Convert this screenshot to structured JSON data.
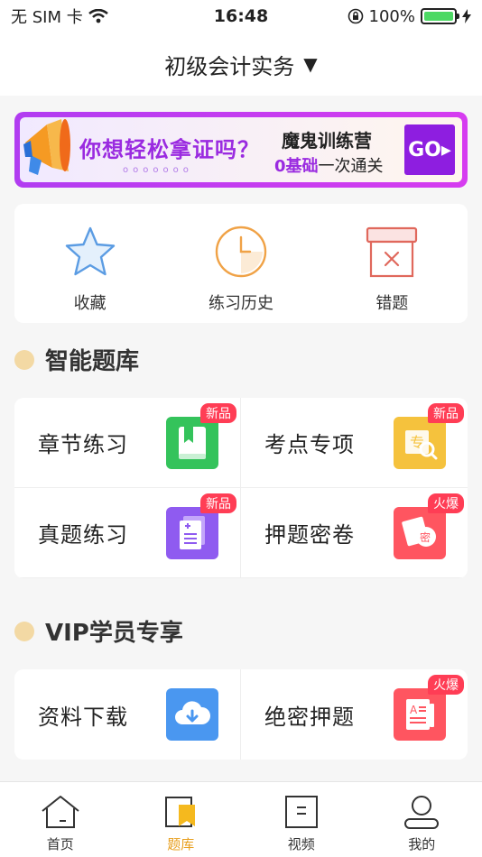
{
  "status_bar": {
    "carrier": "无 SIM 卡",
    "time": "16:48",
    "battery": "100%"
  },
  "header": {
    "title": "初级会计实务",
    "arrow": "▼"
  },
  "banner": {
    "headline": "你想轻松拿证吗？",
    "dots": "ooooooo",
    "right_title": "魔鬼训练营",
    "sub_highlight": "0基础",
    "sub_rest": "一次通关",
    "go": "GO▸"
  },
  "quick_actions": [
    {
      "label": "收藏",
      "icon": "star-icon"
    },
    {
      "label": "练习历史",
      "icon": "clock-icon"
    },
    {
      "label": "错题",
      "icon": "wrong-box-icon"
    }
  ],
  "smart_bank": {
    "title": "智能题库",
    "items": [
      {
        "label": "章节练习",
        "badge": "新品",
        "icon": "book-icon",
        "color": "#34c35b"
      },
      {
        "label": "考点专项",
        "badge": "新品",
        "icon": "topic-search-icon",
        "color": "#f5c23d"
      },
      {
        "label": "真题练习",
        "badge": "新品",
        "icon": "exam-doc-icon",
        "color": "#8f5bf0"
      },
      {
        "label": "押题密卷",
        "badge": "火爆",
        "icon": "secret-paper-icon",
        "color": "#ff5560"
      }
    ]
  },
  "vip": {
    "title": "VIP学员专享",
    "items": [
      {
        "label": "资料下载",
        "badge": "",
        "icon": "cloud-download-icon",
        "color": "#4a97f0"
      },
      {
        "label": "绝密押题",
        "badge": "火爆",
        "icon": "secret-file-icon",
        "color": "#ff5560"
      }
    ]
  },
  "tabbar": [
    {
      "label": "首页",
      "icon": "home-icon",
      "active": false
    },
    {
      "label": "题库",
      "icon": "question-bank-icon",
      "active": true
    },
    {
      "label": "视频",
      "icon": "video-icon",
      "active": false
    },
    {
      "label": "我的",
      "icon": "profile-icon",
      "active": false
    }
  ],
  "colors": {
    "accent": "#e8a020",
    "badge": "#ff3d55",
    "banner_purple": "#9a2be0"
  }
}
